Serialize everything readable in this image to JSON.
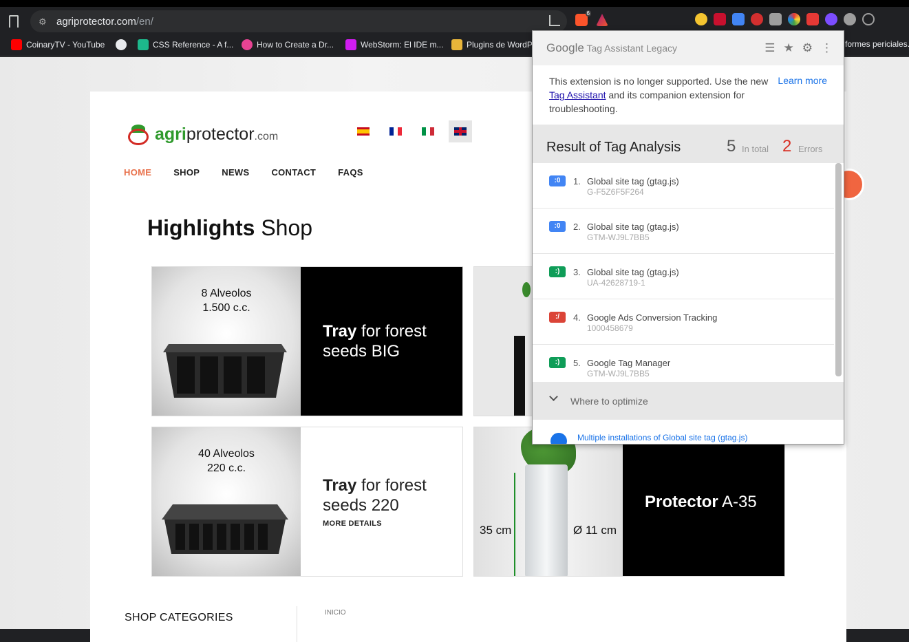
{
  "browser": {
    "url_host": "agriprotector.com",
    "url_path": "/en/",
    "bookmarks": [
      {
        "label": "CoinaryTV - YouTube",
        "color": "#ff0000"
      },
      {
        "label": "",
        "color": "#e8eaed"
      },
      {
        "label": "CSS Reference - A f...",
        "color": "#1db88c"
      },
      {
        "label": "How to Create a Dr...",
        "color": "#e84393"
      },
      {
        "label": "WebStorm: El IDE m...",
        "color": "#d01cf0"
      },
      {
        "label": "Plugins de WordP...",
        "color": "#e8b53a"
      },
      {
        "label": "formes periciales.",
        "color": ""
      }
    ],
    "brave_badge": "6"
  },
  "site": {
    "logo_brand": "agri",
    "logo_rest": "protector",
    "logo_domain": ".com",
    "nav": [
      "HOME",
      "SHOP",
      "NEWS",
      "CONTACT",
      "FAQS"
    ],
    "heading_bold": "Highlights",
    "heading_rest": " Shop",
    "products": [
      {
        "caption1": "8 Alveolos",
        "caption2": "1.500 c.c.",
        "title_bold": "Tray",
        "title_rest": " for forest seeds BIG",
        "more": ""
      },
      {
        "caption1": "40 Alveolos",
        "caption2": "220 c.c.",
        "title_bold": "Tray",
        "title_rest": " for forest seeds 220",
        "more": "MORE DETAILS"
      },
      {
        "height_label": "35 cm",
        "diameter_label": "Ø 11 cm",
        "title_bold": "Protector",
        "title_rest": " A-35"
      }
    ],
    "footer_left": "SHOP CATEGORIES",
    "footer_right": "INICIO"
  },
  "extension": {
    "brand": "Google",
    "product": " Tag Assistant Legacy",
    "notice_pre": "This extension is no longer supported. Use the new ",
    "notice_link": "Tag Assistant",
    "notice_post": " and its companion extension for troubleshooting.",
    "learn_more": "Learn more",
    "result_title": "Result of Tag Analysis",
    "total_count": "5",
    "total_label": "In total",
    "error_count": "2",
    "error_label": "Errors",
    "tags": [
      {
        "num": "1.",
        "name": "Global site tag (gtag.js)",
        "id": "G-F5Z6F5F264",
        "color": "#4285f4",
        "glyph": ":0"
      },
      {
        "num": "2.",
        "name": "Global site tag (gtag.js)",
        "id": "GTM-WJ9L7BB5",
        "color": "#4285f4",
        "glyph": ":0"
      },
      {
        "num": "3.",
        "name": "Global site tag (gtag.js)",
        "id": "UA-42628719-1",
        "color": "#0f9d58",
        "glyph": ":)"
      },
      {
        "num": "4.",
        "name": "Google Ads Conversion Tracking",
        "id": "1000458679",
        "color": "#db4437",
        "glyph": ":/"
      },
      {
        "num": "5.",
        "name": "Google Tag Manager",
        "id": "GTM-WJ9L7BB5",
        "color": "#0f9d58",
        "glyph": ":)"
      }
    ],
    "optimize_title": "Where to optimize",
    "optimize_item": "Multiple installations of Global site tag (gtag.js)"
  }
}
